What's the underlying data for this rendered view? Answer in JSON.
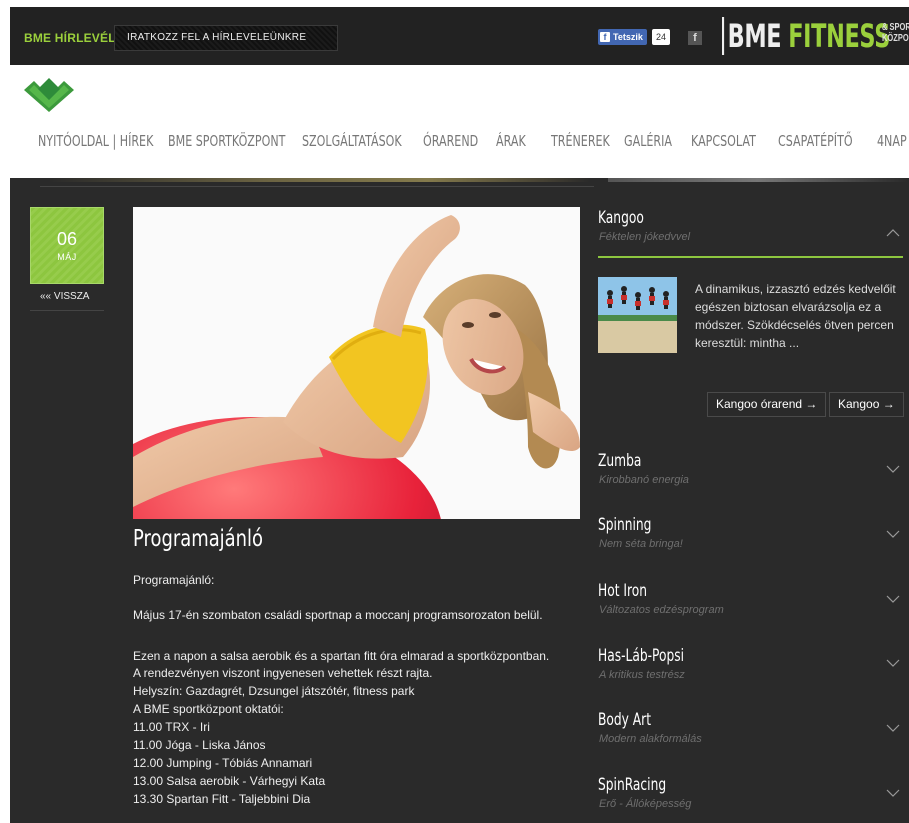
{
  "topbar": {
    "newsletter_label": "BME HÍRLEVÉL",
    "newsletter_button": "IRATKOZZ FEL A HÍRLEVELEÜNKRE",
    "fb_like_label": "Tetszik",
    "fb_like_count": "24",
    "brand_bme": "BME",
    "brand_fitness": "FITNESS",
    "brand_sub_line1": "& SPORT",
    "brand_sub_line2": "KÖZPONT"
  },
  "nav": {
    "items": [
      "NYITÓOLDAL | HÍREK",
      "BME SPORTKÖZPONT",
      "SZOLGÁLTATÁSOK",
      "ÓRAREND",
      "ÁRAK",
      "TRÉNEREK",
      "GALÉRIA",
      "KAPCSOLAT",
      "CSAPATÉPÍTŐ",
      "4NAP"
    ]
  },
  "article": {
    "date_day": "06",
    "date_month": "MÁJ",
    "back_label": "«« VISSZA",
    "title": "Programajánló",
    "intro": "Programajánló:",
    "paragraph1": "Május 17-én szombaton családi sportnap a moccanj programsorozaton belül.",
    "lines": [
      "Ezen a napon a salsa aerobik és a spartan fitt óra elmarad a sportközpontban.",
      "A rendezvényen viszont ingyenesen vehettek részt rajta.",
      "Helyszín: Gazdagrét, Dzsungel játszótér, fitness park",
      "A BME sportközpont oktatói:",
      "11.00 TRX - Iri",
      "11.00 Jóga - Liska János",
      "12.00 Jumping - Tóbiás Annamari",
      "13.00 Salsa aerobik - Várhegyi Kata",
      "13.30 Spartan Fitt - Taljebbini Dia"
    ]
  },
  "sidebar": {
    "kangoo": {
      "title": "Kangoo",
      "subtitle": "Féktelen jókedvvel",
      "description": "A dinamikus, izzasztó edzés kedvelőit egészen biztosan elvarázsolja ez a módszer. Szökdécselés ötven percen keresztül: mintha ...",
      "button_schedule": "Kangoo órarend →",
      "button_more": "Kangoo →"
    },
    "items": [
      {
        "title": "Zumba",
        "subtitle": "Kirobbanó energia"
      },
      {
        "title": "Spinning",
        "subtitle": "Nem séta bringa!"
      },
      {
        "title": "Hot Iron",
        "subtitle": "Változatos edzésprogram"
      },
      {
        "title": "Has-Láb-Popsi",
        "subtitle": "A kritikus testrész"
      },
      {
        "title": "Body Art",
        "subtitle": "Modern alakformálás"
      },
      {
        "title": "SpinRacing",
        "subtitle": "Erő - Állóképesség"
      }
    ]
  },
  "colors": {
    "accent": "#8dc63f",
    "dark_bg": "#2a2a2a",
    "topbar_bg": "#222222"
  }
}
